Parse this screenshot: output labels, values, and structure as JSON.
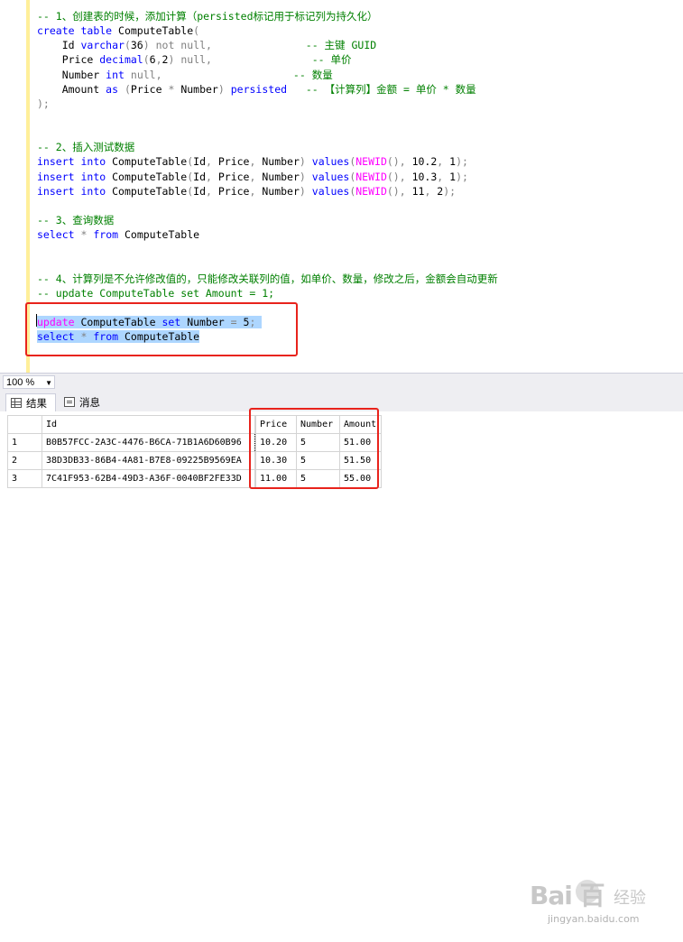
{
  "editor": {
    "lines": [
      {
        "parts": [
          {
            "t": "-- 1、创建表的时候，添加计算（persisted标记用于标记列为持久化）",
            "c": "cm"
          }
        ]
      },
      {
        "parts": [
          {
            "t": "create",
            "c": "kw"
          },
          {
            "t": " "
          },
          {
            "t": "table",
            "c": "kw"
          },
          {
            "t": " ComputeTable"
          },
          {
            "t": "(",
            "c": "gy"
          }
        ]
      },
      {
        "parts": [
          {
            "t": "    Id "
          },
          {
            "t": "varchar",
            "c": "kw"
          },
          {
            "t": "(",
            "c": "gy"
          },
          {
            "t": "36"
          },
          {
            "t": ")",
            "c": "gy"
          },
          {
            "t": " "
          },
          {
            "t": "not null,",
            "c": "gy"
          },
          {
            "t": "               "
          },
          {
            "t": "-- 主键 GUID",
            "c": "cm"
          }
        ]
      },
      {
        "parts": [
          {
            "t": "    Price "
          },
          {
            "t": "decimal",
            "c": "kw"
          },
          {
            "t": "(",
            "c": "gy"
          },
          {
            "t": "6"
          },
          {
            "t": ",",
            "c": "gy"
          },
          {
            "t": "2"
          },
          {
            "t": ")",
            "c": "gy"
          },
          {
            "t": " "
          },
          {
            "t": "null,",
            "c": "gy"
          },
          {
            "t": "                "
          },
          {
            "t": "-- 单价",
            "c": "cm"
          }
        ]
      },
      {
        "parts": [
          {
            "t": "    Number "
          },
          {
            "t": "int",
            "c": "kw"
          },
          {
            "t": " "
          },
          {
            "t": "null,",
            "c": "gy"
          },
          {
            "t": "                     "
          },
          {
            "t": "-- 数量",
            "c": "cm"
          }
        ]
      },
      {
        "parts": [
          {
            "t": "    Amount "
          },
          {
            "t": "as",
            "c": "kw"
          },
          {
            "t": " "
          },
          {
            "t": "(",
            "c": "gy"
          },
          {
            "t": "Price "
          },
          {
            "t": "*",
            "c": "gy"
          },
          {
            "t": " Number"
          },
          {
            "t": ")",
            "c": "gy"
          },
          {
            "t": " "
          },
          {
            "t": "persisted",
            "c": "kw"
          },
          {
            "t": "   "
          },
          {
            "t": "-- 【计算列】金额 = 单价 * 数量",
            "c": "cm"
          }
        ]
      },
      {
        "parts": [
          {
            "t": ");",
            "c": "gy"
          }
        ]
      },
      {
        "parts": []
      },
      {
        "parts": []
      },
      {
        "parts": [
          {
            "t": "-- 2、插入测试数据",
            "c": "cm"
          }
        ]
      },
      {
        "parts": [
          {
            "t": "insert",
            "c": "kw"
          },
          {
            "t": " "
          },
          {
            "t": "into",
            "c": "kw"
          },
          {
            "t": " ComputeTable"
          },
          {
            "t": "(",
            "c": "gy"
          },
          {
            "t": "Id"
          },
          {
            "t": ",",
            "c": "gy"
          },
          {
            "t": " Price"
          },
          {
            "t": ",",
            "c": "gy"
          },
          {
            "t": " Number"
          },
          {
            "t": ")",
            "c": "gy"
          },
          {
            "t": " "
          },
          {
            "t": "values",
            "c": "kw"
          },
          {
            "t": "(",
            "c": "gy"
          },
          {
            "t": "NEWID",
            "c": "fn"
          },
          {
            "t": "(),",
            "c": "gy"
          },
          {
            "t": " 10.2"
          },
          {
            "t": ",",
            "c": "gy"
          },
          {
            "t": " 1"
          },
          {
            "t": ");",
            "c": "gy"
          }
        ]
      },
      {
        "parts": [
          {
            "t": "insert",
            "c": "kw"
          },
          {
            "t": " "
          },
          {
            "t": "into",
            "c": "kw"
          },
          {
            "t": " ComputeTable"
          },
          {
            "t": "(",
            "c": "gy"
          },
          {
            "t": "Id"
          },
          {
            "t": ",",
            "c": "gy"
          },
          {
            "t": " Price"
          },
          {
            "t": ",",
            "c": "gy"
          },
          {
            "t": " Number"
          },
          {
            "t": ")",
            "c": "gy"
          },
          {
            "t": " "
          },
          {
            "t": "values",
            "c": "kw"
          },
          {
            "t": "(",
            "c": "gy"
          },
          {
            "t": "NEWID",
            "c": "fn"
          },
          {
            "t": "(),",
            "c": "gy"
          },
          {
            "t": " 10.3"
          },
          {
            "t": ",",
            "c": "gy"
          },
          {
            "t": " 1"
          },
          {
            "t": ");",
            "c": "gy"
          }
        ]
      },
      {
        "parts": [
          {
            "t": "insert",
            "c": "kw"
          },
          {
            "t": " "
          },
          {
            "t": "into",
            "c": "kw"
          },
          {
            "t": " ComputeTable"
          },
          {
            "t": "(",
            "c": "gy"
          },
          {
            "t": "Id"
          },
          {
            "t": ",",
            "c": "gy"
          },
          {
            "t": " Price"
          },
          {
            "t": ",",
            "c": "gy"
          },
          {
            "t": " Number"
          },
          {
            "t": ")",
            "c": "gy"
          },
          {
            "t": " "
          },
          {
            "t": "values",
            "c": "kw"
          },
          {
            "t": "(",
            "c": "gy"
          },
          {
            "t": "NEWID",
            "c": "fn"
          },
          {
            "t": "(),",
            "c": "gy"
          },
          {
            "t": " 11"
          },
          {
            "t": ",",
            "c": "gy"
          },
          {
            "t": " 2"
          },
          {
            "t": ");",
            "c": "gy"
          }
        ]
      },
      {
        "parts": []
      },
      {
        "parts": [
          {
            "t": "-- 3、查询数据",
            "c": "cm"
          }
        ]
      },
      {
        "parts": [
          {
            "t": "select",
            "c": "kw"
          },
          {
            "t": " "
          },
          {
            "t": "*",
            "c": "gy"
          },
          {
            "t": " "
          },
          {
            "t": "from",
            "c": "kw"
          },
          {
            "t": " ComputeTable"
          }
        ]
      },
      {
        "parts": []
      },
      {
        "parts": []
      },
      {
        "parts": [
          {
            "t": "-- 4、计算列是不允许修改值的，只能修改关联列的值，如单价、数量，修改之后，金额会自动更新",
            "c": "cm"
          }
        ]
      },
      {
        "parts": [
          {
            "t": "-- update ComputeTable set Amount = 1;",
            "c": "cm"
          }
        ]
      },
      {
        "parts": []
      },
      {
        "sel": true,
        "parts": [
          {
            "t": "update",
            "c": "fn"
          },
          {
            "t": " ComputeTable "
          },
          {
            "t": "set",
            "c": "kw"
          },
          {
            "t": " Number "
          },
          {
            "t": "=",
            "c": "gy"
          },
          {
            "t": " 5"
          },
          {
            "t": ";",
            "c": "gy"
          },
          {
            "t": " "
          }
        ]
      },
      {
        "sel": true,
        "parts": [
          {
            "t": "select",
            "c": "kw"
          },
          {
            "t": " "
          },
          {
            "t": "*",
            "c": "gy"
          },
          {
            "t": " "
          },
          {
            "t": "from",
            "c": "kw"
          },
          {
            "t": " ComputeTable"
          }
        ]
      }
    ]
  },
  "statusbar": {
    "zoom": "100 %"
  },
  "tabs": {
    "results": "结果",
    "messages": "消息"
  },
  "results": {
    "columns": [
      "Id",
      "Price",
      "Number",
      "Amount"
    ],
    "rows": [
      {
        "n": "1",
        "id": "B0B57FCC-2A3C-4476-B6CA-71B1A6D60B96",
        "price": "10.20",
        "number": "5",
        "amount": "51.00"
      },
      {
        "n": "2",
        "id": "38D3DB33-86B4-4A81-B7E8-09225B9569EA",
        "price": "10.30",
        "number": "5",
        "amount": "51.50"
      },
      {
        "n": "3",
        "id": "7C41F953-62B4-49D3-A36F-0040BF2FE33D",
        "price": "11.00",
        "number": "5",
        "amount": "55.00"
      }
    ]
  },
  "watermark": {
    "logo": "Bai  百",
    "sub": "经验",
    "url": "jingyan.baidu.com"
  },
  "colors": {
    "keyword": "#0000ff",
    "comment": "#008000",
    "function": "#ff00ff",
    "selection": "#add6ff",
    "highlight": "#e8231c"
  }
}
